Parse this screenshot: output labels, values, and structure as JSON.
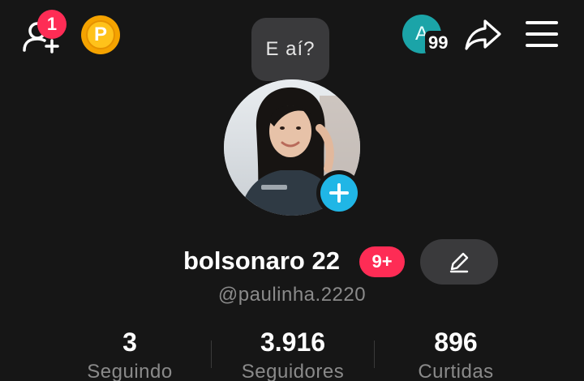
{
  "header": {
    "friend_requests_count": "1",
    "coin_label": "P",
    "account_initial": "A",
    "account_notifications": "99"
  },
  "icons": {
    "add_friend": "add-user-icon",
    "coin": "coin-icon",
    "share": "share-arrow-icon",
    "menu": "hamburger-menu-icon",
    "add_photo": "plus-icon",
    "edit": "pencil-icon"
  },
  "bubble": {
    "text": "E aí?"
  },
  "profile": {
    "display_name": "bolsonaro 22",
    "badge": "9+",
    "handle": "@paulinha.2220"
  },
  "stats": [
    {
      "value": "3",
      "label": "Seguindo"
    },
    {
      "value": "3.916",
      "label": "Seguidores"
    },
    {
      "value": "896",
      "label": "Curtidas"
    }
  ],
  "colors": {
    "background": "#161616",
    "accent_red": "#fe2c55",
    "add_photo_blue": "#20b6e6",
    "coin_gold": "#ffc21a",
    "account_teal": "#1ba4a8"
  }
}
